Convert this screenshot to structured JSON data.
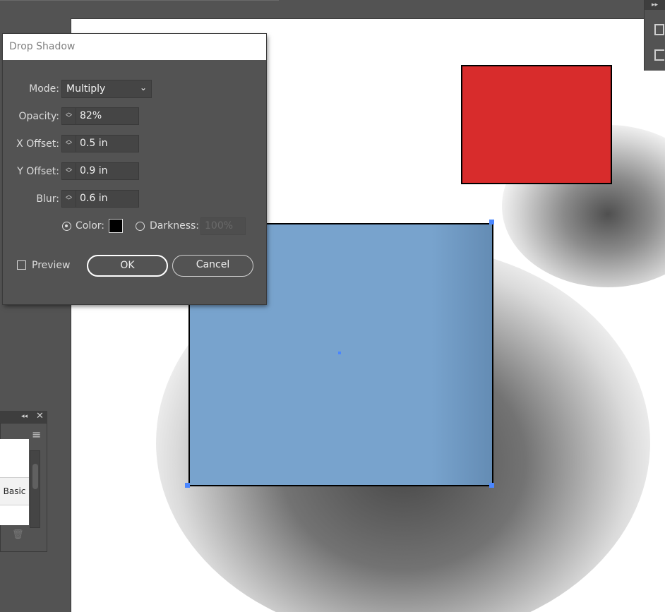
{
  "dialog": {
    "title": "Drop Shadow",
    "mode_label": "Mode:",
    "mode_value": "Multiply",
    "opacity_label": "Opacity:",
    "opacity_value": "82%",
    "x_offset_label": "X Offset:",
    "x_offset_value": "0.5 in",
    "y_offset_label": "Y Offset:",
    "y_offset_value": "0.9 in",
    "blur_label": "Blur:",
    "blur_value": "0.6 in",
    "color_label": "Color:",
    "color_selected": true,
    "color_swatch": "#000000",
    "darkness_label": "Darkness:",
    "darkness_value": "100%",
    "preview_label": "Preview",
    "preview_checked": false,
    "ok_label": "OK",
    "cancel_label": "Cancel"
  },
  "left_panel": {
    "list_item_label": "Basic"
  },
  "canvas": {
    "background": "#ffffff",
    "red_rect_color": "#d82c2c",
    "blue_rect_color": "#78a3cd",
    "selection_color": "#4a86ff"
  },
  "icons": {
    "stepper": "up-down-chevrons-icon",
    "mode_dropdown": "chevron-down-icon",
    "panel_menu": "hamburger-menu-icon",
    "panel_close": "close-icon",
    "panel_collapse": "double-chevron-icon",
    "trash": "trash-icon"
  }
}
